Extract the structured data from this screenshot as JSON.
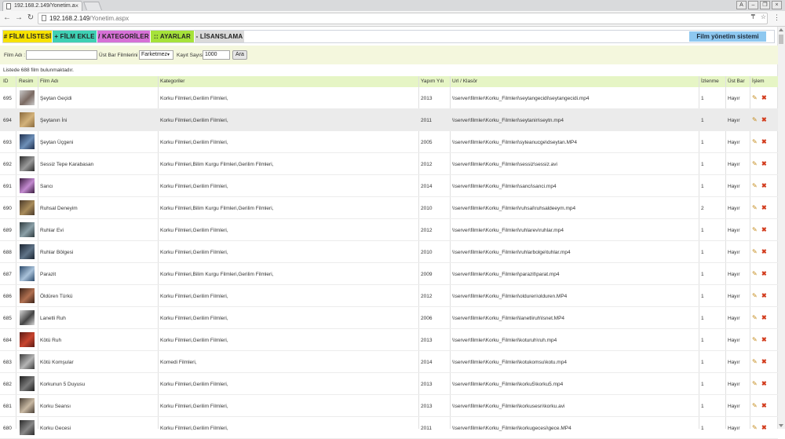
{
  "browser": {
    "tab_title": "192.168.2.149/Yonetim.a",
    "url_host": "192.168.2.149",
    "url_path": "/Yonetim.aspx"
  },
  "menu": {
    "items": [
      {
        "label": "# FİLM LİSTESİ",
        "color": "#f7e200"
      },
      {
        "label": "+ FİLM EKLE",
        "color": "#3fd0b4"
      },
      {
        "label": "/ KATEGORİLER",
        "color": "#d671d6"
      },
      {
        "label": ":: AYARLAR",
        "color": "#a6e23a"
      },
      {
        "label": "- LİSANSLAMA",
        "color": "#dadada"
      }
    ],
    "system_title": "Film yönetim sistemi",
    "system_color": "#8ec8f0"
  },
  "filters": {
    "film_name_label": "Film Adı :",
    "film_name_value": "",
    "top_bar_label": "Üst Bar Filmlerini :",
    "top_bar_value": "Farketmez",
    "record_count_label": "Kayıt Sayısı",
    "record_count_value": "1000",
    "search_button": "Ara"
  },
  "summary": "Listede 688 film bulunmaktadır.",
  "table": {
    "headers": {
      "id": "ID",
      "image": "Resim",
      "name": "Film Adı",
      "categories": "Kategoriler",
      "year": "Yapım Yılı",
      "url": "Url / Klasör",
      "views": "İzlenme",
      "top_bar": "Üst Bar",
      "actions": "İşlem"
    },
    "rows": [
      {
        "id": "695",
        "name": "Şeytan Geçidi",
        "categories": "Korku Filmleri,Gerilim Filmleri,",
        "year": "2013",
        "url": "\\\\server\\filmler\\Korku_Filmleri\\seytangecidi\\seytangecidi.mp4",
        "views": "1",
        "top_bar": "Hayır",
        "thumb": [
          "#c9c9c9",
          "#7b6a62"
        ]
      },
      {
        "id": "694",
        "name": "Şeytanın İni",
        "categories": "Korku Filmleri,Gerilim Filmleri,",
        "year": "2011",
        "url": "\\\\server\\filmler\\Korku_Filmleri\\seytanin\\seytn.mp4",
        "views": "1",
        "top_bar": "Hayır",
        "thumb": [
          "#8a6a3d",
          "#d3b27a"
        ]
      },
      {
        "id": "693",
        "name": "Şeytan Üçgeni",
        "categories": "Korku Filmleri,Gerilim Filmleri,",
        "year": "2005",
        "url": "\\\\server\\filmler\\Korku_Filmleri\\syteanucge\\dseytan.MP4",
        "views": "1",
        "top_bar": "Hayır",
        "thumb": [
          "#1f2f4d",
          "#6d8fb8"
        ]
      },
      {
        "id": "692",
        "name": "Sessiz Tepe Karabasan",
        "categories": "Korku Filmleri,Bilim Kurgu Filmleri,Gerilim Filmleri,",
        "year": "2012",
        "url": "\\\\server\\filmler\\Korku_Filmleri\\sessiz\\sessiz.avi",
        "views": "1",
        "top_bar": "Hayır",
        "thumb": [
          "#2b2b2b",
          "#9a9a9a"
        ]
      },
      {
        "id": "691",
        "name": "Sancı",
        "categories": "Korku Filmleri,Gerilim Filmleri,",
        "year": "2014",
        "url": "\\\\server\\filmler\\Korku_Filmleri\\sanci\\sanci.mp4",
        "views": "1",
        "top_bar": "Hayır",
        "thumb": [
          "#3a1c3f",
          "#c38ad0"
        ]
      },
      {
        "id": "690",
        "name": "Ruhsal Deneyim",
        "categories": "Korku Filmleri,Bilim Kurgu Filmleri,Gerilim Filmleri,",
        "year": "2010",
        "url": "\\\\server\\filmler\\Korku_Filmleri\\ruhsal\\ruhsaldeeym.mp4",
        "views": "2",
        "top_bar": "Hayır",
        "thumb": [
          "#4a3a2a",
          "#a88b5a"
        ]
      },
      {
        "id": "689",
        "name": "Ruhlar Evi",
        "categories": "Korku Filmleri,Gerilim Filmleri,",
        "year": "2012",
        "url": "\\\\server\\filmler\\Korku_Filmleri\\ruhlarev\\ruhlar.mp4",
        "views": "1",
        "top_bar": "Hayır",
        "thumb": [
          "#2e3b3f",
          "#8ba0a8"
        ]
      },
      {
        "id": "688",
        "name": "Ruhlar Bölgesi",
        "categories": "Korku Filmleri,Gerilim Filmleri,",
        "year": "2010",
        "url": "\\\\server\\filmler\\Korku_Filmleri\\ruhlarbolge\\tuhlar.mp4",
        "views": "1",
        "top_bar": "Hayır",
        "thumb": [
          "#1a2430",
          "#5f7387"
        ]
      },
      {
        "id": "687",
        "name": "Parazit",
        "categories": "Korku Filmleri,Bilim Kurgu Filmleri,Gerilim Filmleri,",
        "year": "2009",
        "url": "\\\\server\\filmler\\Korku_Filmleri\\parazit\\parat.mp4",
        "views": "1",
        "top_bar": "Hayır",
        "thumb": [
          "#2c4a6a",
          "#a9c2da"
        ]
      },
      {
        "id": "686",
        "name": "Öldüren Türkü",
        "categories": "Korku Filmleri,Gerilim Filmleri,",
        "year": "2012",
        "url": "\\\\server\\filmler\\Korku_Filmleri\\olduren\\olduren.MP4",
        "views": "1",
        "top_bar": "Hayır",
        "thumb": [
          "#3b2218",
          "#b07050"
        ]
      },
      {
        "id": "685",
        "name": "Lanetli Ruh",
        "categories": "Korku Filmleri,Gerilim Filmleri,",
        "year": "2006",
        "url": "\\\\server\\filmler\\Korku_Filmleri\\lanetliruh\\lsnet.MP4",
        "views": "1",
        "top_bar": "Hayır",
        "thumb": [
          "#d7d7d7",
          "#444444"
        ]
      },
      {
        "id": "684",
        "name": "Kötü Ruh",
        "categories": "Korku Filmleri,Gerilim Filmleri,",
        "year": "2013",
        "url": "\\\\server\\filmler\\Korku_Filmleri\\koturuh\\ruh.mp4",
        "views": "1",
        "top_bar": "Hayır",
        "thumb": [
          "#5a1a14",
          "#c9452f"
        ]
      },
      {
        "id": "683",
        "name": "Kötü Komşular",
        "categories": "Komedi Filmleri,",
        "year": "2014",
        "url": "\\\\server\\filmler\\Korku_Filmleri\\kotukomsu\\kotu.mp4",
        "views": "1",
        "top_bar": "Hayır",
        "thumb": [
          "#3c3c3c",
          "#b5b5b5"
        ]
      },
      {
        "id": "682",
        "name": "Korkunun 5 Duyusu",
        "categories": "Korku Filmleri,Gerilim Filmleri,",
        "year": "2013",
        "url": "\\\\server\\filmler\\Korku_Filmleri\\korku5\\korku5.mp4",
        "views": "1",
        "top_bar": "Hayır",
        "thumb": [
          "#1e1e1e",
          "#7a7a7a"
        ]
      },
      {
        "id": "681",
        "name": "Korku Seansı",
        "categories": "Korku Filmleri,Gerilim Filmleri,",
        "year": "2013",
        "url": "\\\\server\\filmler\\Korku_Filmleri\\korkusesn\\korku.avi",
        "views": "1",
        "top_bar": "Hayır",
        "thumb": [
          "#4a4036",
          "#c8b8a2"
        ]
      },
      {
        "id": "680",
        "name": "Korku Gecesi",
        "categories": "Korku Filmleri,Gerilim Filmleri,",
        "year": "2011",
        "url": "\\\\server\\filmler\\Korku_Filmleri\\korkugecesi\\gece.MP4",
        "views": "1",
        "top_bar": "Hayır",
        "thumb": [
          "#2a2a2a",
          "#888888"
        ]
      }
    ]
  },
  "icons": {
    "edit": "pencil-icon",
    "delete": "cross-icon"
  }
}
